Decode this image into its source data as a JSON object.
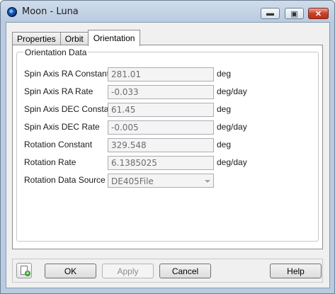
{
  "window": {
    "title": "Moon - Luna",
    "controls": {
      "minimize": "▬",
      "maximize": "▣",
      "close": "✕"
    }
  },
  "tabs": [
    {
      "label": "Properties",
      "active": false
    },
    {
      "label": "Orbit",
      "active": false
    },
    {
      "label": "Orientation",
      "active": true
    }
  ],
  "orientation": {
    "group_title": "Orientation Data",
    "rows": [
      {
        "label": "Spin Axis RA Constant",
        "value": "281.01",
        "unit": "deg"
      },
      {
        "label": "Spin Axis RA Rate",
        "value": "-0.033",
        "unit": "deg/day"
      },
      {
        "label": "Spin Axis DEC Constant",
        "value": "61.45",
        "unit": "deg"
      },
      {
        "label": "Spin Axis DEC Rate",
        "value": "-0.005",
        "unit": "deg/day"
      },
      {
        "label": "Rotation Constant",
        "value": "329.548",
        "unit": "deg"
      },
      {
        "label": "Rotation Rate",
        "value": "6.1385025",
        "unit": "deg/day"
      }
    ],
    "source": {
      "label": "Rotation Data Source",
      "selected": "DE405File"
    }
  },
  "buttons": {
    "ok": "OK",
    "apply": "Apply",
    "cancel": "Cancel",
    "help": "Help"
  },
  "icons": {
    "app": "moon-app-icon",
    "script": "new-script-icon"
  }
}
